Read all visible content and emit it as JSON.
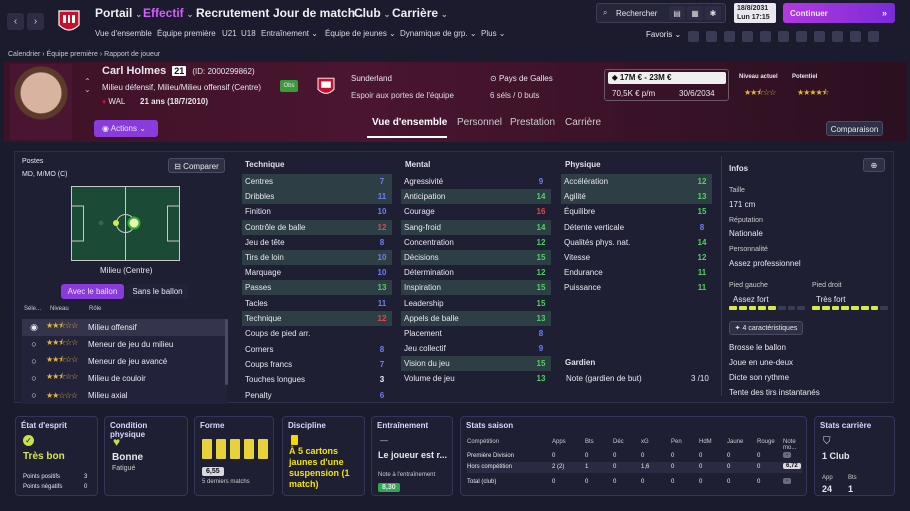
{
  "topbar": {
    "nav": [
      "Portail",
      "Effectif",
      "Recrutement",
      "Jour de match",
      "Club",
      "Carrière"
    ],
    "active_nav": "Effectif",
    "subnav": [
      "Vue d'ensemble",
      "Équipe première",
      "U21",
      "U18",
      "Entraînement",
      "Équipe de jeunes",
      "Dynamique de grp.",
      "Plus"
    ],
    "search_label": "Rechercher",
    "date_line1": "18/8/2031",
    "date_line2": "Lun  17:15",
    "continue_label": "Continuer",
    "favs_label": "Favoris"
  },
  "breadcrumb": [
    "Calendrier",
    "Équipe première",
    "Rapport de joueur"
  ],
  "player": {
    "name": "Carl Holmes",
    "number": "21",
    "id": "(ID: 2000299862)",
    "positions": "Milieu défensif, Milieu/Milieu offensif (Centre)",
    "nationality_code": "WAL",
    "age": "21 ans (18/7/2010)",
    "obs_badge": "Obs",
    "club": "Sunderland",
    "club_status": "Espoir aux portes de l'équipe",
    "country": "Pays de Galles",
    "caps": "6 séls / 0 buts",
    "value": "17M € - 23M €",
    "wage": "70,5K € p/m",
    "contract": "30/6/2034",
    "current_level_label": "Niveau actuel",
    "potential_label": "Potentiel",
    "current_level_stars": 2.5,
    "potential_stars": 4.5,
    "actions_label": "Actions"
  },
  "tabs": [
    "Vue d'ensemble",
    "Personnel",
    "Prestation",
    "Carrière"
  ],
  "compare_label": "Comparaison",
  "positions_panel": {
    "title": "Postes",
    "pos_text": "MD, M/MO (C)",
    "compare_btn": "Comparer",
    "role_caption": "Milieu (Centre)",
    "toggle_with": "Avec le ballon",
    "toggle_without": "Sans le ballon",
    "headers": [
      "Séle...",
      "Niveau",
      "Rôle"
    ],
    "roles": [
      {
        "stars": 2.5,
        "name": "Milieu offensif",
        "selected": true
      },
      {
        "stars": 2.5,
        "name": "Meneur de jeu du milieu",
        "selected": false
      },
      {
        "stars": 2.5,
        "name": "Meneur de jeu avancé",
        "selected": false
      },
      {
        "stars": 2.5,
        "name": "Milieu de couloir",
        "selected": false
      },
      {
        "stars": 2.0,
        "name": "Milieu axial",
        "selected": false
      }
    ]
  },
  "technique": {
    "title": "Technique",
    "rows": [
      {
        "name": "Centres",
        "v": "7",
        "c": "blue",
        "hl": true
      },
      {
        "name": "Dribbles",
        "v": "11",
        "c": "blue",
        "hl": true
      },
      {
        "name": "Finition",
        "v": "10",
        "c": "blue",
        "hl": false
      },
      {
        "name": "Contrôle de balle",
        "v": "12",
        "c": "red",
        "hl": true
      },
      {
        "name": "Jeu de tête",
        "v": "8",
        "c": "blue",
        "hl": false
      },
      {
        "name": "Tirs de loin",
        "v": "10",
        "c": "blue",
        "hl": true
      },
      {
        "name": "Marquage",
        "v": "10",
        "c": "blue",
        "hl": false
      },
      {
        "name": "Passes",
        "v": "13",
        "c": "green",
        "hl": true
      },
      {
        "name": "Tacles",
        "v": "11",
        "c": "blue",
        "hl": false
      },
      {
        "name": "Technique",
        "v": "12",
        "c": "red",
        "hl": true
      }
    ],
    "set_title": "Coups de pied arr.",
    "set_rows": [
      {
        "name": "Corners",
        "v": "8",
        "c": "blue"
      },
      {
        "name": "Coups francs",
        "v": "7",
        "c": "blue"
      },
      {
        "name": "Touches longues",
        "v": "3",
        "c": "white"
      },
      {
        "name": "Penalty",
        "v": "6",
        "c": "blue"
      }
    ]
  },
  "mental": {
    "title": "Mental",
    "rows": [
      {
        "name": "Agressivité",
        "v": "9",
        "c": "blue",
        "hl": false
      },
      {
        "name": "Anticipation",
        "v": "14",
        "c": "green",
        "hl": true
      },
      {
        "name": "Courage",
        "v": "16",
        "c": "red",
        "hl": false
      },
      {
        "name": "Sang-froid",
        "v": "14",
        "c": "green",
        "hl": true
      },
      {
        "name": "Concentration",
        "v": "12",
        "c": "green",
        "hl": false
      },
      {
        "name": "Décisions",
        "v": "15",
        "c": "green",
        "hl": true
      },
      {
        "name": "Détermination",
        "v": "12",
        "c": "green",
        "hl": false
      },
      {
        "name": "Inspiration",
        "v": "15",
        "c": "green",
        "hl": true
      },
      {
        "name": "Leadership",
        "v": "15",
        "c": "green",
        "hl": false
      },
      {
        "name": "Appels de balle",
        "v": "13",
        "c": "green",
        "hl": true
      },
      {
        "name": "Placement",
        "v": "8",
        "c": "blue",
        "hl": false
      },
      {
        "name": "Jeu collectif",
        "v": "9",
        "c": "blue",
        "hl": false
      },
      {
        "name": "Vision du jeu",
        "v": "15",
        "c": "green",
        "hl": true
      },
      {
        "name": "Volume de jeu",
        "v": "13",
        "c": "green",
        "hl": false
      }
    ]
  },
  "physique": {
    "title": "Physique",
    "rows": [
      {
        "name": "Accélération",
        "v": "12",
        "c": "green",
        "hl": true
      },
      {
        "name": "Agilité",
        "v": "13",
        "c": "green",
        "hl": true
      },
      {
        "name": "Équilibre",
        "v": "15",
        "c": "green",
        "hl": false
      },
      {
        "name": "Détente verticale",
        "v": "8",
        "c": "blue",
        "hl": false
      },
      {
        "name": "Qualités phys. nat.",
        "v": "14",
        "c": "green",
        "hl": false
      },
      {
        "name": "Vitesse",
        "v": "12",
        "c": "green",
        "hl": false
      },
      {
        "name": "Endurance",
        "v": "11",
        "c": "green",
        "hl": false
      },
      {
        "name": "Puissance",
        "v": "11",
        "c": "green",
        "hl": false
      }
    ],
    "gk_title": "Gardien",
    "gk_label": "Note (gardien de but)",
    "gk_value": "3 /10"
  },
  "info": {
    "title": "Infos",
    "height_label": "Taille",
    "height": "171 cm",
    "rep_label": "Réputation",
    "rep": "Nationale",
    "pers_label": "Personnalité",
    "pers": "Assez professionnel",
    "left_foot_label": "Pied gauche",
    "left_foot": "Assez fort",
    "left_foot_level": 0.6,
    "right_foot_label": "Pied droit",
    "right_foot": "Très fort",
    "right_foot_level": 0.9,
    "traits_btn": "4 caractéristiques",
    "traits": [
      "Brosse le ballon",
      "Joue en une-deux",
      "Dicte son rythme",
      "Tente des tirs instantanés"
    ]
  },
  "cards": {
    "mood": {
      "title": "État d'esprit",
      "value": "Très bon",
      "pos_label": "Points positifs",
      "pos": "3",
      "neg_label": "Points négatifs",
      "neg": "0"
    },
    "condition": {
      "title": "Condition physique",
      "value": "Bonne",
      "sub": "Fatigué"
    },
    "form": {
      "title": "Forme",
      "rating": "6,55",
      "sub": "5 derniers matchs"
    },
    "discipline": {
      "title": "Discipline",
      "text": "À 5 cartons jaunes d'une suspension (1 match)"
    },
    "training": {
      "title": "Entraînement",
      "text": "Le joueur est r...",
      "note_label": "Note à l'entraînement",
      "note": "8,30"
    },
    "season": {
      "title": "Stats saison",
      "headers": [
        "Compétition",
        "Apps",
        "Bts",
        "Déc",
        "xG",
        "Pen",
        "HdM",
        "Jaune",
        "Rouge",
        "Note mo..."
      ],
      "rows": [
        [
          "Première Division",
          "0",
          "0",
          "0",
          "0",
          "0",
          "0",
          "0",
          "0",
          "-"
        ],
        [
          "Hors compétition",
          "2 (2)",
          "1",
          "0",
          "1,6",
          "0",
          "0",
          "0",
          "0",
          "6,72"
        ],
        [
          "Total (club)",
          "0",
          "0",
          "0",
          "0",
          "0",
          "0",
          "0",
          "0",
          "-"
        ]
      ]
    },
    "career": {
      "title": "Stats carrière",
      "clubs": "1 Club",
      "app_label": "App",
      "apps": "24",
      "bts_label": "Bts",
      "bts": "1"
    }
  }
}
